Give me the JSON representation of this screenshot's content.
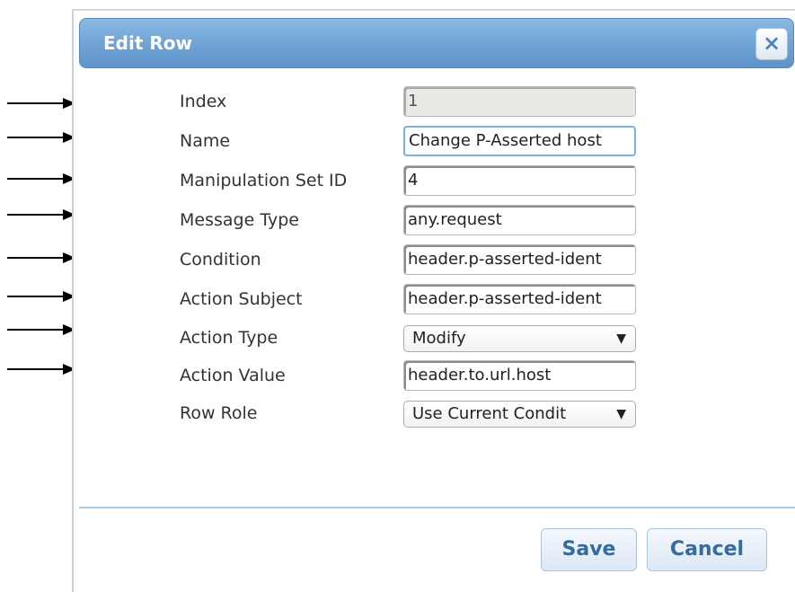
{
  "dialog": {
    "title": "Edit Row",
    "close_label": "×"
  },
  "fields": [
    {
      "label": "Index",
      "value": "1",
      "kind": "input",
      "state": "disabled"
    },
    {
      "label": "Name",
      "value": "Change P-Asserted host",
      "kind": "input",
      "state": "focused"
    },
    {
      "label": "Manipulation Set ID",
      "value": "4",
      "kind": "input",
      "state": "normal"
    },
    {
      "label": "Message Type",
      "value": "any.request",
      "kind": "input",
      "state": "normal"
    },
    {
      "label": "Condition",
      "value": "header.p-asserted-ident",
      "kind": "input",
      "state": "normal"
    },
    {
      "label": "Action Subject",
      "value": "header.p-asserted-ident",
      "kind": "input",
      "state": "normal"
    },
    {
      "label": "Action Type",
      "value": "Modify",
      "kind": "select",
      "state": "normal"
    },
    {
      "label": "Action Value",
      "value": "header.to.url.host",
      "kind": "input",
      "state": "normal"
    },
    {
      "label": "Row Role",
      "value": "Use Current Condit",
      "kind": "select",
      "state": "normal"
    }
  ],
  "caret": "▼",
  "buttons": {
    "save": "Save",
    "cancel": "Cancel"
  },
  "icons": {
    "close": "close-icon",
    "dropdown": "chevron-down-icon",
    "annotation": "arrow-right-icon"
  }
}
